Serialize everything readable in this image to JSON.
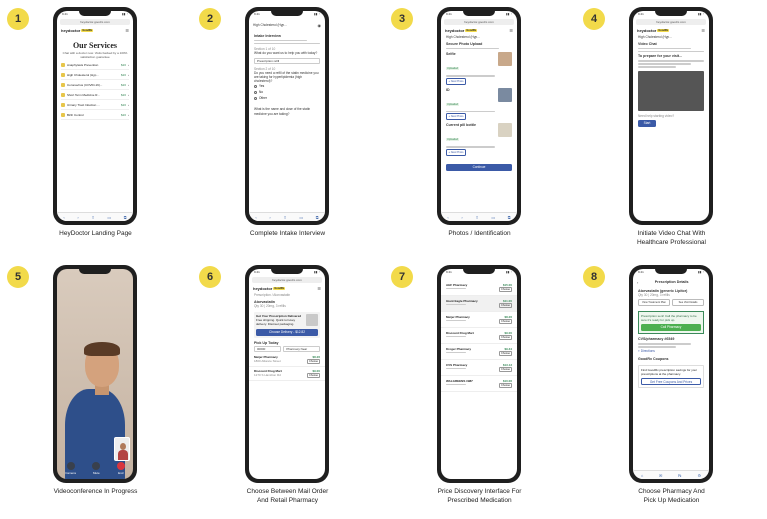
{
  "panels": [
    {
      "number": "1",
      "caption": [
        "HeyDoctor Landing Page"
      ],
      "screen": {
        "url": "heydoctor.goodrx.com",
        "logo": "heydoctor",
        "logo_tag": "GoodRx",
        "title": "Our Services",
        "subtitle": "Chat with a doctor now. Visits backed by a 100% satisfaction guarantee",
        "services": [
          {
            "name": "Anaphylaxis Prevention",
            "price": "$20"
          },
          {
            "name": "High Cholesterol (Hyp...",
            "price": "$20"
          },
          {
            "name": "Coronavirus (COVID-19)...",
            "price": "$20"
          },
          {
            "name": "Short Term Medicine R...",
            "price": "$20"
          },
          {
            "name": "Urinary Tract Infection ...",
            "price": "$20"
          },
          {
            "name": "Birth Control",
            "price": "$20"
          }
        ]
      }
    },
    {
      "number": "2",
      "caption": [
        "Complete Intake Interview"
      ],
      "screen": {
        "service": "High Cholesterol (Hyp...",
        "section_title": "Intake Interview",
        "q1_label": "Section 1 of 10",
        "q1": "What do you want us to help you with today?",
        "q1_answer": "Prescription refill",
        "q2_label": "Section 2 of 10",
        "q2": "Do you need a refill of the statin medicine you are taking for hyperlipidemia (high cholesterol)?",
        "options": [
          "Yes",
          "No",
          "Other"
        ],
        "q3": "What is the name and dose of the statin medicine you are taking?"
      }
    },
    {
      "number": "3",
      "caption": [
        "Photos / Identification"
      ],
      "screen": {
        "url": "heydoctor.goodrx.com",
        "logo": "heydoctor",
        "logo_tag": "GoodRx",
        "service": "High Cholesterol (Hyp...",
        "section_title": "Secure Photo Upload",
        "items": [
          {
            "name": "Selfie",
            "status": "Uploaded",
            "action": "+ New Photo"
          },
          {
            "name": "ID",
            "status": "Uploaded",
            "action": "+ New Photo"
          },
          {
            "name": "Current pill bottle",
            "status": "Uploaded",
            "action": "+ New Photo"
          }
        ],
        "continue_label": "Continue"
      }
    },
    {
      "number": "4",
      "caption": [
        "Initiate Video Chat With",
        "Healthcare Professional"
      ],
      "screen": {
        "url": "heydoctor.goodrx.com",
        "logo": "heydoctor",
        "logo_tag": "GoodRx",
        "service": "High Cholesterol (Hyp...",
        "section_title": "Video Chat",
        "prep_title": "To prepare for your visit...",
        "help_text": "Need help starting video?",
        "start_label": "Start"
      }
    },
    {
      "number": "5",
      "caption": [
        "Videoconference In Progress"
      ],
      "screen": {
        "controls": [
          "Camera",
          "Mute",
          "End"
        ]
      }
    },
    {
      "number": "6",
      "caption": [
        "Choose Between Mail Order",
        "And Retail Pharmacy"
      ],
      "screen": {
        "url": "heydoctor.goodrx.com",
        "logo": "heydoctor",
        "logo_tag": "GoodRx",
        "breadcrumb": "Prescription / Atorvastatin",
        "drug": "Atorvastatin",
        "drug_sub": "Qty 30 | 20mg, 3 refills",
        "delivery_title": "Get Your Prescription Delivered",
        "delivery_text": "Free shipping. Quick turn-key delivery. Discreet packaging.",
        "delivery_button": "Choose Delivery - $12.82",
        "pickup_title": "Pick Up Today",
        "zip": "00000",
        "pharmacy_near": "Pharmacy Near",
        "pharmacies": [
          {
            "name": "Meijer Pharmacy",
            "addr": "1800 Alliance Street",
            "price": "$8.26",
            "action": "Choose"
          },
          {
            "name": "Discount Drug Mart",
            "addr": "1270 S Hamilton Rd",
            "price": "$9.00",
            "action": "Choose"
          }
        ]
      }
    },
    {
      "number": "7",
      "caption": [
        "Price Discovery Interface For",
        "Prescribed Medication"
      ],
      "screen": {
        "pharmacies": [
          {
            "name": "AHF Pharmacy",
            "price": "$15.00",
            "action": "Choose"
          },
          {
            "name": "Giant Eagle Pharmacy",
            "price": "$11.00",
            "action": "Choose"
          },
          {
            "name": "Meijer Pharmacy",
            "price": "$8.26",
            "action": "Choose"
          },
          {
            "name": "Discount Drug Mart",
            "price": "$9.00",
            "action": "Choose"
          },
          {
            "name": "Kroger Pharmacy",
            "price": "$9.34",
            "action": "Choose"
          },
          {
            "name": "CVS Pharmacy",
            "price": "$13.13",
            "action": "Choose"
          },
          {
            "name": "WALGREENS #987",
            "price": "$10.06",
            "action": "Choose"
          }
        ]
      }
    },
    {
      "number": "8",
      "caption": [
        "Choose Pharmacy And",
        "Pick Up Medication"
      ],
      "screen": {
        "header_title": "Prescription Details",
        "drug": "Atorvastatin (generic Lipitor)",
        "drug_sub": "Qty 30 | 20mg, 3 refills",
        "tab1": "View Treatment Plan",
        "tab2": "See Visit Details",
        "note": "Prescription sent! Call the pharmacy to be sure it's ready for pick up.",
        "call_label": "Call Pharmacy",
        "pharmacy": "CVS/pharmacy #6549",
        "directions": "Directions",
        "coupon_title": "GoodRx Coupons",
        "coupon_text": "Find GoodRx prescription savings for your prescriptions at the pharmacy.",
        "coupon_button": "Get Free Coupons And Prices"
      }
    }
  ]
}
